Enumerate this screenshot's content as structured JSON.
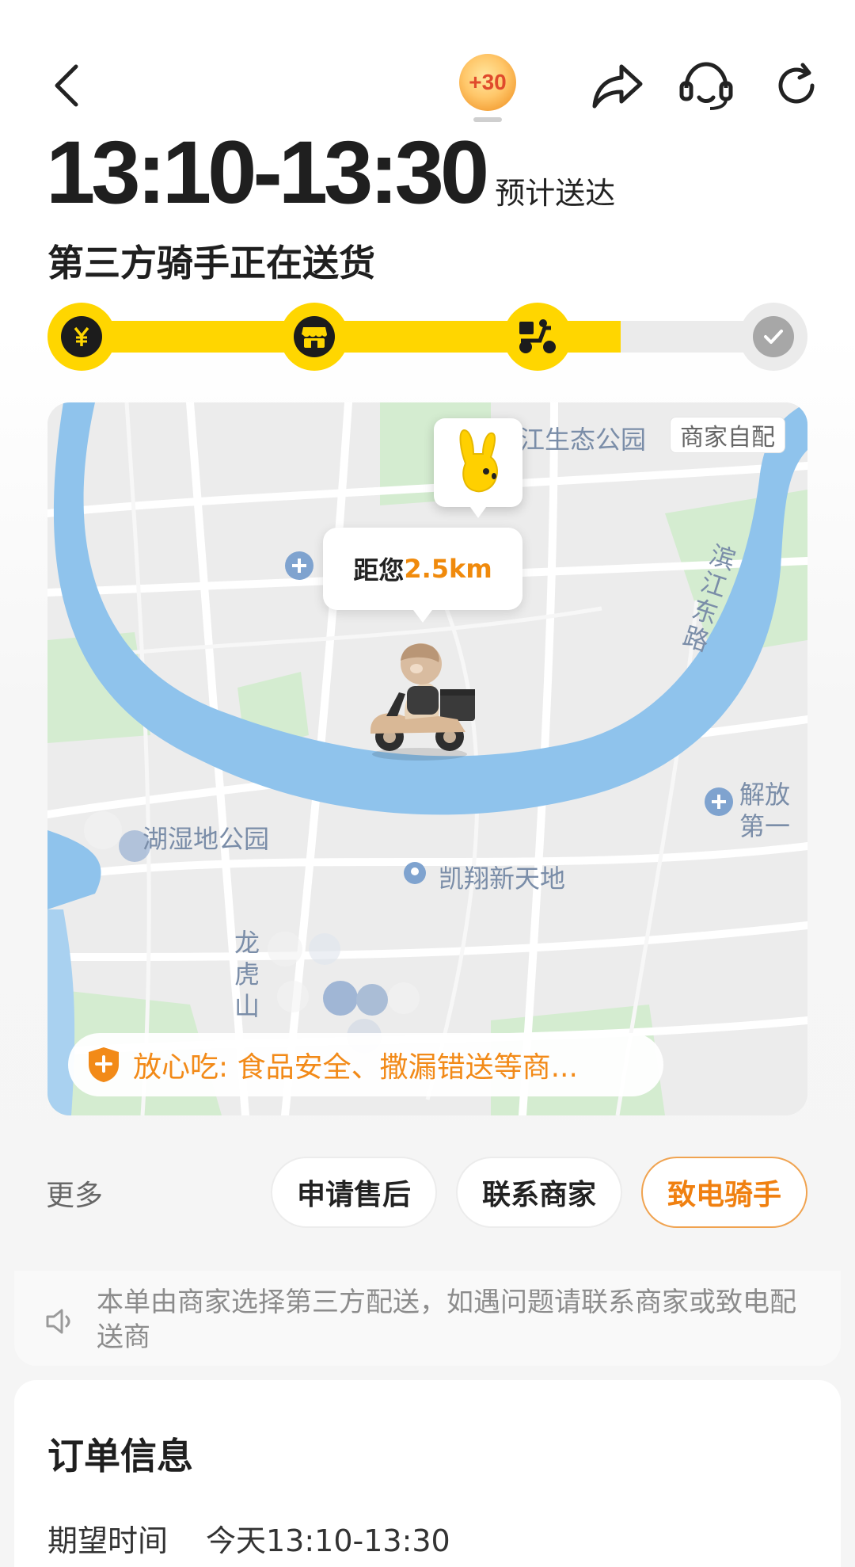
{
  "header": {
    "back_icon": "chevron-left-icon",
    "coin_badge": "+30",
    "share_icon": "share-icon",
    "service_icon": "headset-icon",
    "refresh_icon": "refresh-icon"
  },
  "delivery": {
    "eta_time": "13:10-13:30",
    "eta_label": "预计送达",
    "status": "第三方骑手正在送货",
    "progress_fraction": 0.76,
    "steps": [
      {
        "icon": "yen-icon",
        "done": true
      },
      {
        "icon": "store-icon",
        "done": true
      },
      {
        "icon": "scooter-icon",
        "done": true
      },
      {
        "icon": "check-icon",
        "done": false
      }
    ]
  },
  "map": {
    "merchant_tag": "商家自配",
    "distance_prefix": "距您",
    "distance_value": "2.5km",
    "labels": {
      "park_top": "江生态公园",
      "road_right": "滨江东路",
      "right_edge_1": "解放",
      "right_edge_2": "第一",
      "wetland": "湖湿地公园",
      "mall": "凯翔新天地",
      "road_left": "龙虎山"
    },
    "safety_text": "放心吃: 食品安全、撒漏错送等商...",
    "colors": {
      "river": "#8fc3ec",
      "park": "#d4ecd0",
      "land": "#ececec"
    }
  },
  "actions": {
    "more": "更多",
    "after_sale": "申请售后",
    "contact_merchant": "联系商家",
    "call_rider": "致电骑手"
  },
  "notice": {
    "icon": "speaker-icon",
    "text": "本单由商家选择第三方配送，如遇问题请联系商家或致电配送商"
  },
  "order": {
    "title": "订单信息",
    "expect_label": "期望时间",
    "expect_value": "今天13:10-13:30"
  },
  "colors": {
    "accent_yellow": "#ffd600",
    "accent_orange": "#f08a0c"
  }
}
